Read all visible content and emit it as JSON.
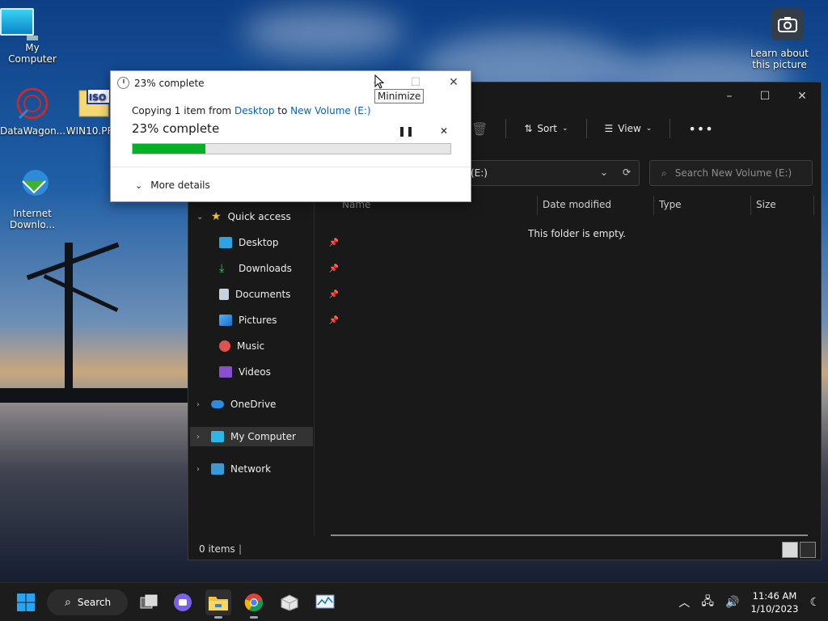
{
  "desktop": {
    "icons": [
      {
        "label": "My Computer"
      },
      {
        "label": "DataWagon..."
      },
      {
        "label": "WIN10.PRO"
      },
      {
        "label": "Internet Downlo..."
      }
    ],
    "learn_label": "Learn about this picture"
  },
  "copy_dialog": {
    "title": "23% complete",
    "copying_prefix": "Copying 1 item from",
    "source": "Desktop",
    "to_word": "to",
    "destination": "New Volume (E:)",
    "status_big": "23% complete",
    "progress_percent": 23,
    "more_details": "More details",
    "tooltip": "Minimize"
  },
  "explorer": {
    "toolbar": {
      "sort": "Sort",
      "view": "View"
    },
    "address": "(E:)",
    "search_placeholder": "Search New Volume (E:)",
    "nav": {
      "quick_access": "Quick access",
      "desktop": "Desktop",
      "downloads": "Downloads",
      "documents": "Documents",
      "pictures": "Pictures",
      "music": "Music",
      "videos": "Videos",
      "onedrive": "OneDrive",
      "my_computer": "My Computer",
      "network": "Network"
    },
    "columns": {
      "name": "Name",
      "date": "Date modified",
      "type": "Type",
      "size": "Size"
    },
    "empty_message": "This folder is empty.",
    "status_count": "0 items"
  },
  "taskbar": {
    "search_label": "Search",
    "time": "11:46 AM",
    "date": "1/10/2023"
  },
  "colors": {
    "progress": "#06b025",
    "link": "#0b62b5",
    "accent": "#0078d4"
  }
}
